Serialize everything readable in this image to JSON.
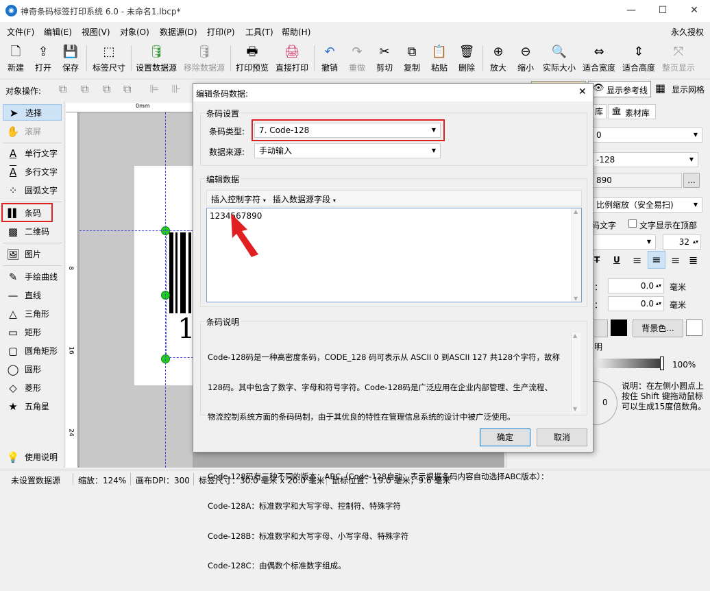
{
  "window": {
    "title": "神奇条码标签打印系统 6.0 - 未命名1.lbcp*",
    "minimize": "—",
    "maximize": "☐",
    "close": "✕"
  },
  "menu": [
    "文件(F)",
    "编辑(E)",
    "视图(V)",
    "对象(O)",
    "数据源(D)",
    "打印(P)",
    "工具(T)",
    "帮助(H)"
  ],
  "license": "永久授权",
  "toolbar": [
    {
      "label": "新建",
      "icon": "new-file-icon",
      "glyph": "🗋"
    },
    {
      "label": "打开",
      "icon": "open-icon",
      "glyph": "⇪"
    },
    {
      "label": "保存",
      "icon": "save-icon",
      "glyph": "💾"
    },
    {
      "label": "标签尺寸",
      "icon": "label-size-icon",
      "glyph": "⬚"
    },
    {
      "label": "设置数据源",
      "icon": "database-icon",
      "glyph": "🛢"
    },
    {
      "label": "移除数据源",
      "icon": "database-remove-icon",
      "glyph": "🛢"
    },
    {
      "label": "打印预览",
      "icon": "print-preview-icon",
      "glyph": "🖶"
    },
    {
      "label": "直接打印",
      "icon": "printer-icon",
      "glyph": "🖨"
    },
    {
      "label": "撤销",
      "icon": "undo-icon",
      "glyph": "↶"
    },
    {
      "label": "重做",
      "icon": "redo-icon",
      "glyph": "↷"
    },
    {
      "label": "剪切",
      "icon": "cut-icon",
      "glyph": "✂"
    },
    {
      "label": "复制",
      "icon": "copy-icon",
      "glyph": "⧉"
    },
    {
      "label": "粘贴",
      "icon": "paste-icon",
      "glyph": "📋"
    },
    {
      "label": "删除",
      "icon": "trash-icon",
      "glyph": "🗑"
    },
    {
      "label": "放大",
      "icon": "zoom-in-icon",
      "glyph": "⊕"
    },
    {
      "label": "缩小",
      "icon": "zoom-out-icon",
      "glyph": "⊖"
    },
    {
      "label": "实际大小",
      "icon": "zoom-actual-icon",
      "glyph": "🔍"
    },
    {
      "label": "适合宽度",
      "icon": "fit-width-icon",
      "glyph": "⇔"
    },
    {
      "label": "适合高度",
      "icon": "fit-height-icon",
      "glyph": "⇕"
    },
    {
      "label": "整页显示",
      "icon": "fit-page-icon",
      "glyph": "⤧"
    }
  ],
  "objbar": {
    "label": "对象操作:",
    "show_ref": "显示参考线",
    "show_grid": "显示网格"
  },
  "tools": [
    {
      "label": "选择",
      "icon": "cursor-icon",
      "glyph": "➤"
    },
    {
      "label": "滚屏",
      "icon": "hand-icon",
      "glyph": "✋"
    },
    {
      "label": "单行文字",
      "icon": "single-text-icon",
      "glyph": "A"
    },
    {
      "label": "多行文字",
      "icon": "multi-text-icon",
      "glyph": "A"
    },
    {
      "label": "圆弧文字",
      "icon": "arc-text-icon",
      "glyph": "⁘"
    },
    {
      "label": "条码",
      "icon": "barcode-icon",
      "glyph": "▌▌"
    },
    {
      "label": "二维码",
      "icon": "qrcode-icon",
      "glyph": "▩"
    },
    {
      "label": "图片",
      "icon": "image-icon",
      "glyph": "🖼"
    },
    {
      "label": "手绘曲线",
      "icon": "pen-icon",
      "glyph": "✎"
    },
    {
      "label": "直线",
      "icon": "line-icon",
      "glyph": "—"
    },
    {
      "label": "三角形",
      "icon": "triangle-icon",
      "glyph": "△"
    },
    {
      "label": "矩形",
      "icon": "rectangle-icon",
      "glyph": "▭"
    },
    {
      "label": "圆角矩形",
      "icon": "rounded-rect-icon",
      "glyph": "▢"
    },
    {
      "label": "圆形",
      "icon": "circle-icon",
      "glyph": "◯"
    },
    {
      "label": "菱形",
      "icon": "diamond-icon",
      "glyph": "◇"
    },
    {
      "label": "五角星",
      "icon": "star-icon",
      "glyph": "★"
    },
    {
      "label": "使用说明",
      "icon": "lightbulb-icon",
      "glyph": "💡"
    }
  ],
  "ruler": {
    "top_zero": "0mm",
    "left_marks": [
      "8",
      "16",
      "24"
    ]
  },
  "canvas": {
    "barcode_digit": "1"
  },
  "right": {
    "tab_a": "库",
    "tab_b": "素材库",
    "field1": "0",
    "field2": "-128",
    "field3": "890",
    "more": "...",
    "scale_mode": "比例缩放（安全易扫)",
    "show_text": "码文字",
    "text_top": "文字显示在顶部",
    "font_size": "32",
    "x_label": "：",
    "x_val": "0.0",
    "y_label": "：",
    "y_val": "0.0",
    "unit": "毫米",
    "bg_color": "背景色...",
    "partial": "明",
    "opacity": "100%",
    "rot_val": "0",
    "note": "说明：在左侧小圆点上按住 Shift 键拖动鼠标可以生成15度倍数角。"
  },
  "status": {
    "datasource": "未设置数据源",
    "zoom": "缩放：124%",
    "dpi": "画布DPI：300",
    "size": "标签尺寸：30.0 毫米 x 20.0 毫米",
    "mouse": "鼠标位置：19.0 毫米，9.6 毫米"
  },
  "dialog": {
    "title": "编辑条码数据:",
    "close": "✕",
    "barcode_settings": "条码设置",
    "type_label": "条码类型:",
    "type_value": "7.  Code-128",
    "source_label": "数据来源:",
    "source_value": "手动输入",
    "edit_data": "编辑数据",
    "insert_ctrl": "插入控制字符",
    "insert_field": "插入数据源字段",
    "data_value": "1234567890",
    "desc_label": "条码说明",
    "desc_lines": [
      "Code-128码是一种高密度条码，CODE_128 码可表示从 ASCII 0 到ASCII 127 共128个字符，故称",
      "128码。其中包含了数字、字母和符号字符。Code-128码是广泛应用在企业内部管理、生产流程、",
      "物流控制系统方面的条码码制，由于其优良的特性在管理信息系统的设计中被广泛使用。",
      "",
      "Code-128码有三种不同的版本：ABC（Code-128自动：表示根据条码内容自动选择ABC版本）：",
      "Code-128A：标准数字和大写字母、控制符、特殊字符",
      "Code-128B：标准数字和大写字母、小写字母、特殊字符",
      "Code-128C：由偶数个标准数字组成。"
    ],
    "ok": "确定",
    "cancel": "取消"
  },
  "colors": {
    "accent_red": "#e02020",
    "handle_green": "#22cc22",
    "app_blue": "#1a73c8"
  }
}
